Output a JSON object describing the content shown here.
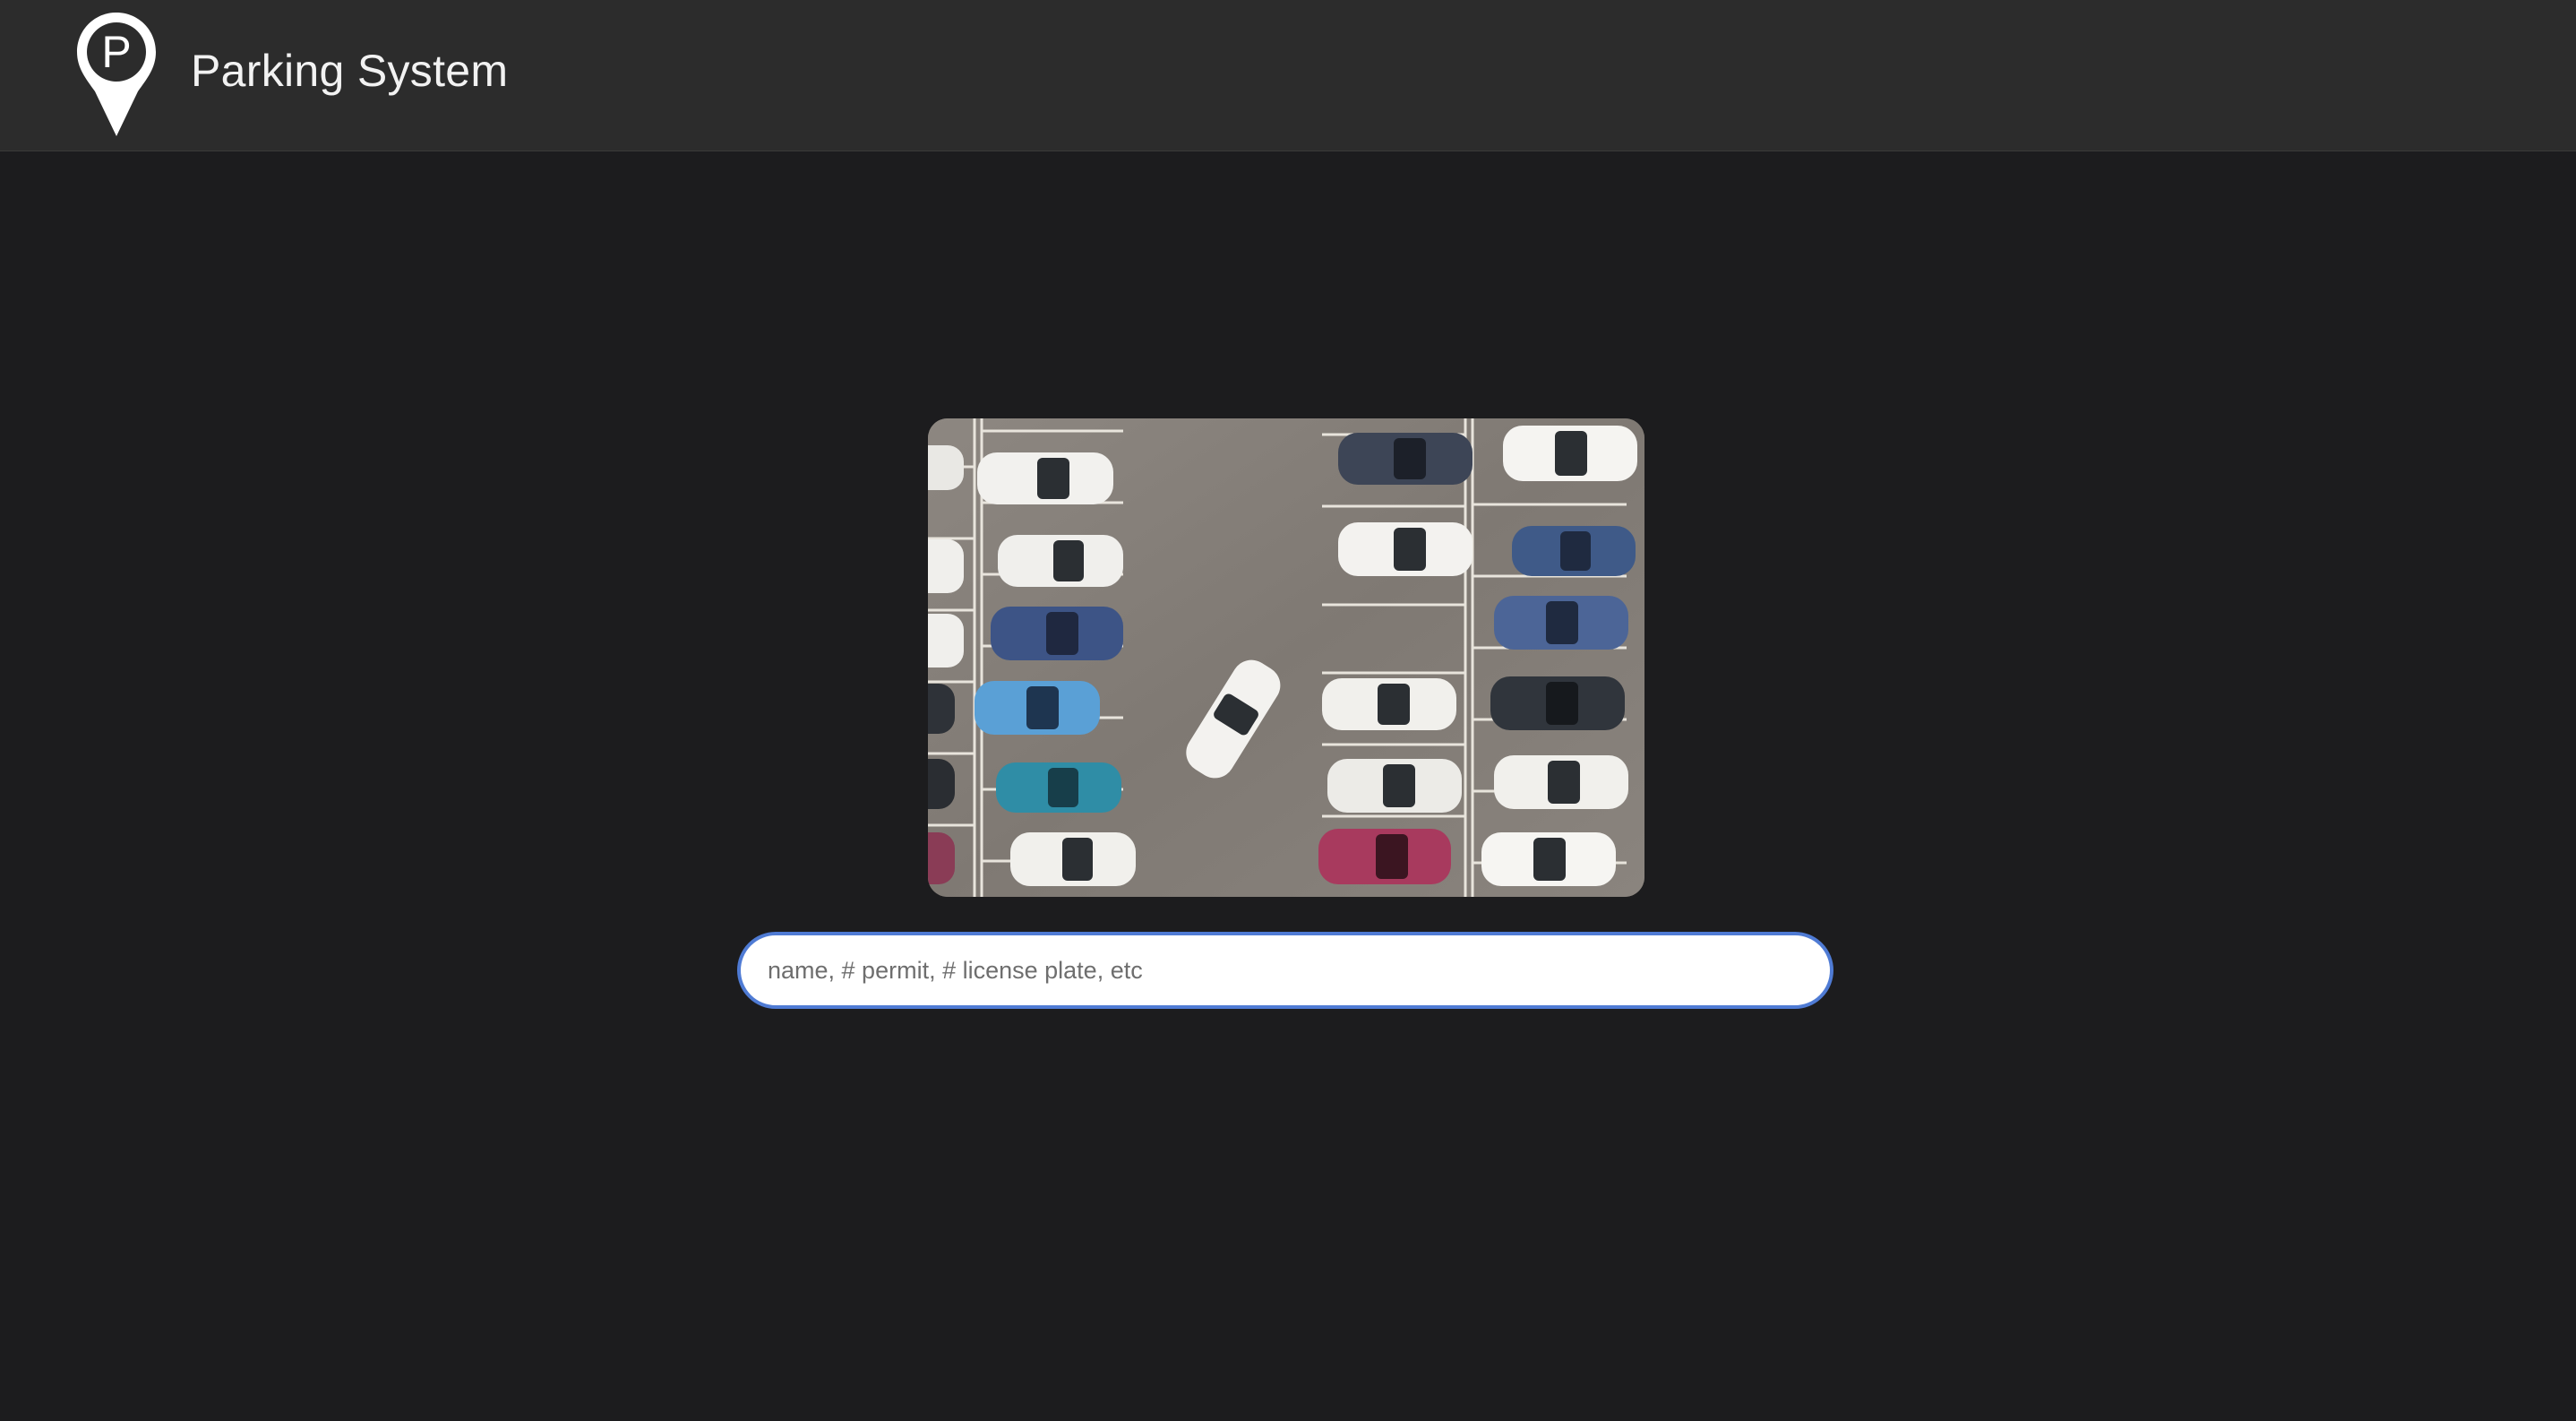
{
  "header": {
    "title": "Parking System",
    "logo_icon": "parking-location-pin-icon",
    "logo_letter": "P"
  },
  "hero": {
    "image": "aerial-parking-lot-photo"
  },
  "search": {
    "placeholder": "name, # permit, # license plate, etc",
    "value": ""
  },
  "colors": {
    "background": "#1c1c1e",
    "header": "#2c2c2c",
    "search_border": "#4f7bd4"
  }
}
